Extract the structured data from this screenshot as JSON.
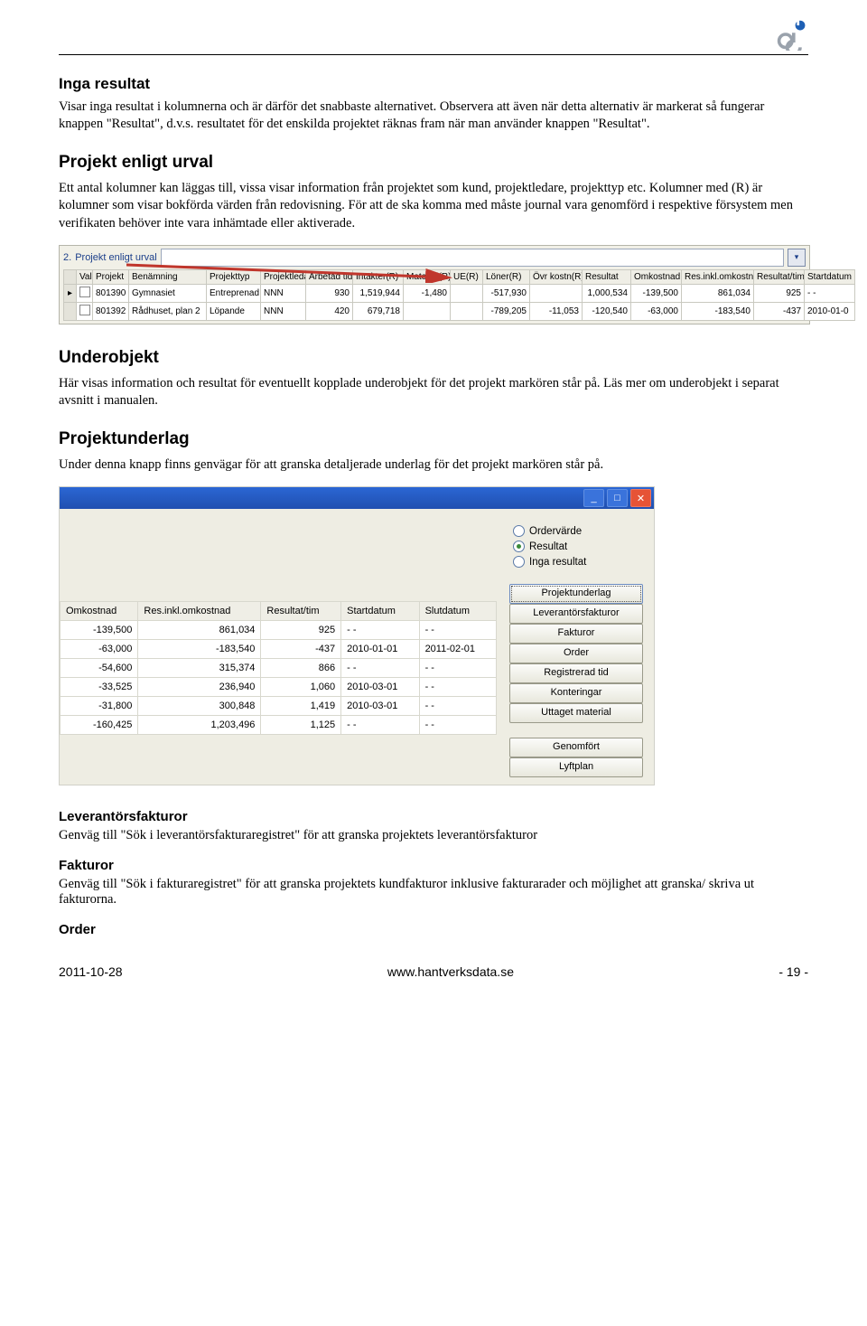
{
  "logo": {
    "alt": "ob-logo"
  },
  "sec1": {
    "title": "Inga resultat",
    "text": "Visar inga resultat i kolumnerna och är därför det snabbaste alternativet. Observera att även när detta alternativ är markerat så fungerar knappen \"Resultat\", d.v.s. resultatet för det enskilda projektet räknas fram när man använder knappen \"Resultat\"."
  },
  "sec2": {
    "title": "Projekt enligt urval",
    "text": "Ett antal kolumner kan läggas till, vissa visar information från projektet som kund, projektledare, projekttyp etc. Kolumner med (R) är kolumner som visar bokförda värden från redovisning. För att de ska komma med måste journal vara genomförd i respektive försystem men verifikaten behöver inte vara inhämtade eller aktiverade."
  },
  "shot1": {
    "heading_num": "2.",
    "heading_text": "Projekt enligt urval",
    "headers": [
      "Vald",
      "Projekt",
      "Benämning",
      "Projekttyp",
      "Projektledare",
      "Arbetad tid",
      "Intäkter(R)",
      "Material(R)",
      "UE(R)",
      "Löner(R)",
      "Övr kostn(R)",
      "Resultat",
      "Omkostnad",
      "Res.inkl.omkostnad",
      "Resultat/tim",
      "Startdatum"
    ],
    "rows": [
      {
        "vald": "",
        "projekt": "801390",
        "benamning": "Gymnasiet",
        "typ": "Entreprenad",
        "ledare": "NNN",
        "tid": "930",
        "intakter": "1,519,944",
        "material": "-1,480",
        "ue": "",
        "loner": "-517,930",
        "ovr": "",
        "resultat": "1,000,534",
        "omk": "-139,500",
        "resinkl": "861,034",
        "rtim": "925",
        "start": "- -"
      },
      {
        "vald": "",
        "projekt": "801392",
        "benamning": "Rådhuset, plan 2",
        "typ": "Löpande",
        "ledare": "NNN",
        "tid": "420",
        "intakter": "679,718",
        "material": "",
        "ue": "",
        "loner": "-789,205",
        "ovr": "-11,053",
        "resultat": "-120,540",
        "omk": "-63,000",
        "resinkl": "-183,540",
        "rtim": "-437",
        "start": "2010-01-0"
      }
    ]
  },
  "sec3": {
    "title": "Underobjekt",
    "text": "Här visas information och resultat för eventuellt kopplade underobjekt för det projekt markören står på. Läs mer om underobjekt i separat avsnitt i manualen."
  },
  "sec4": {
    "title": "Projektunderlag",
    "text": "Under denna knapp finns genvägar för att granska detaljerade underlag för det projekt markören står på."
  },
  "shot2": {
    "radios": [
      {
        "label": "Ordervärde",
        "on": false
      },
      {
        "label": "Resultat",
        "on": true
      },
      {
        "label": "Inga resultat",
        "on": false
      }
    ],
    "buttons": [
      "Projektunderlag",
      "Leverantörsfakturor",
      "Fakturor",
      "Order",
      "Registrerad tid",
      "Konteringar",
      "Uttaget material"
    ],
    "buttons_active_index": 0,
    "buttons2": [
      "Genomfört",
      "Lyftplan"
    ],
    "table_headers": [
      "Omkostnad",
      "Res.inkl.omkostnad",
      "Resultat/tim",
      "Startdatum",
      "Slutdatum"
    ],
    "table_rows": [
      {
        "omk": "-139,500",
        "resinkl": "861,034",
        "rtim": "925",
        "start": "- -",
        "slut": "- -"
      },
      {
        "omk": "-63,000",
        "resinkl": "-183,540",
        "rtim": "-437",
        "start": "2010-01-01",
        "slut": "2011-02-01"
      },
      {
        "omk": "-54,600",
        "resinkl": "315,374",
        "rtim": "866",
        "start": "- -",
        "slut": "- -"
      },
      {
        "omk": "-33,525",
        "resinkl": "236,940",
        "rtim": "1,060",
        "start": "2010-03-01",
        "slut": "- -"
      },
      {
        "omk": "-31,800",
        "resinkl": "300,848",
        "rtim": "1,419",
        "start": "2010-03-01",
        "slut": "- -"
      },
      {
        "omk": "-160,425",
        "resinkl": "1,203,496",
        "rtim": "1,125",
        "start": "- -",
        "slut": "- -"
      }
    ]
  },
  "sec5": {
    "t1": "Leverantörsfakturor",
    "p1": "Genväg till \"Sök i leverantörsfakturaregistret\" för att granska projektets leverantörsfakturor",
    "t2": "Fakturor",
    "p2": "Genväg till \"Sök i fakturaregistret\" för att granska projektets kundfakturor inklusive fakturarader och möjlighet att granska/ skriva ut fakturorna.",
    "t3": "Order"
  },
  "footer": {
    "date": "2011-10-28",
    "url": "www.hantverksdata.se",
    "page": "- 19 -"
  }
}
